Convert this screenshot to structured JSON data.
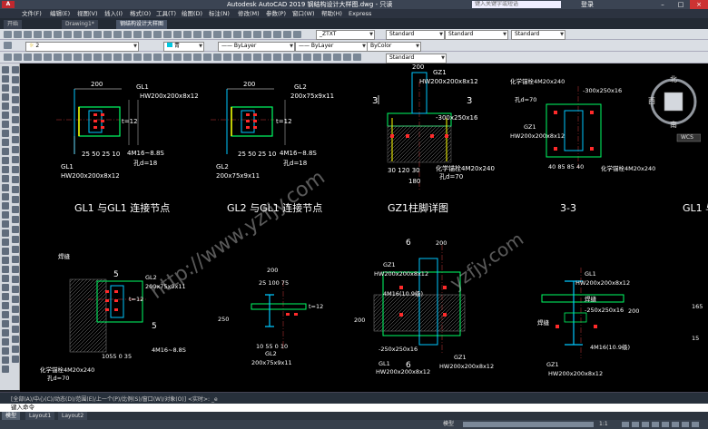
{
  "app": {
    "title": "Autodesk AutoCAD 2019    钢结构设计大样图.dwg - 只读",
    "logo": "A",
    "search_placeholder": "键入关键字或短语",
    "login_label": "登录"
  },
  "menu": [
    "文件(F)",
    "编辑(E)",
    "视图(V)",
    "插入(I)",
    "格式(O)",
    "工具(T)",
    "绘图(D)",
    "标注(N)",
    "修改(M)",
    "参数(P)",
    "窗口(W)",
    "帮助(H)",
    "Express"
  ],
  "file_tabs": [
    "开始",
    "Drawing1*",
    "钢结构设计大样图"
  ],
  "toolbars": {
    "text_style": "_ZTXT",
    "dim_style": "Standard",
    "table_style": "Standard",
    "mleader_style": "Standard",
    "layer": "2",
    "color": "青",
    "linetype": "ByLayer",
    "lineweight": "ByLayer",
    "plotstyle": "ByColor",
    "style2": "Standard"
  },
  "viewcube": {
    "north": "北",
    "west": "西",
    "south": "南",
    "wcs": "WCS"
  },
  "drawing": {
    "gl1": "GL1",
    "gl2": "GL2",
    "gz1": "GZ1",
    "hw200": "HW200x200x8x12",
    "pl200": "200x75x9x11",
    "dim_200": "200",
    "dim_t12": "t=12",
    "dim_25": "25 50 25 10",
    "dim_4m16": "4M16~8.8S",
    "hole_18": "孔d=18",
    "plate_300": "-300x250x16",
    "anchor": "化学锚栓4M20x240",
    "hole_70": "孔d=70",
    "dims_30": "30  120  30",
    "dims_180": "180",
    "dims_40": "40  85  85  40",
    "plate_250": "-250x250x16",
    "cap_6": "6",
    "cap_5": "5",
    "cap_3": "3",
    "dims_2510": "25 100  75",
    "dims_1010": "10 55 0 10",
    "dims_1055": "1055 0 35",
    "label_title1": "GL1 与GL1 连接节点",
    "label_title2": "GL2 与GL1 连接节点",
    "label_title3": "GZ1柱脚详图",
    "label_title4": "3-3",
    "label_title5": "GL1 与",
    "weld": "焊缝",
    "bolt_4m16": "4M16(10.9级)",
    "d_200b": "200",
    "d_250": "250",
    "d_15": "15",
    "d_165": "165"
  },
  "command": {
    "history": "[全部(A)/中心(C)/动态(D)/范围(E)/上一个(P)/比例(S)/窗口(W)/对象(O)] <实时>: _e",
    "prompt": "键入命令"
  },
  "layout_tabs": [
    "模型",
    "Layout1",
    "Layout2"
  ],
  "status": {
    "model": "模型",
    "scale": "1:1"
  }
}
